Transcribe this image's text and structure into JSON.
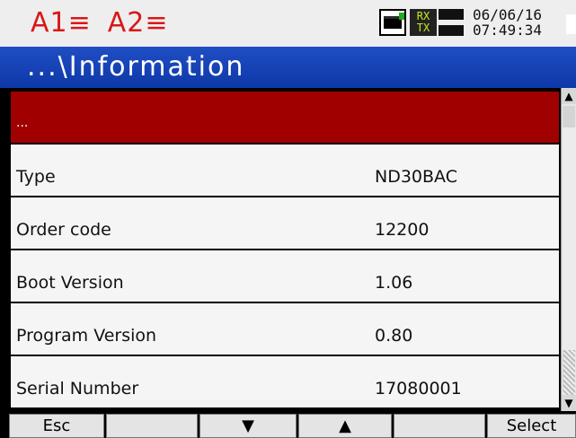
{
  "status": {
    "alarm1": "A1≡",
    "alarm2": "A2≡",
    "rx_label": "RX",
    "tx_label": "TX",
    "date": "06/06/16",
    "time": "07:49:34",
    "icons": [
      "display-flag-icon",
      "rx-tx-indicator-icon"
    ]
  },
  "title": "...\\Information",
  "list": {
    "header_label": "...",
    "rows": [
      {
        "label": "Type",
        "value": "ND30BAC"
      },
      {
        "label": "Order code",
        "value": "12200"
      },
      {
        "label": "Boot Version",
        "value": "1.06"
      },
      {
        "label": "Program Version",
        "value": "0.80"
      },
      {
        "label": "Serial Number",
        "value": "17080001"
      }
    ]
  },
  "softkeys": [
    "Esc",
    "",
    "▼",
    "▲",
    "",
    "Select"
  ],
  "colors": {
    "title_bar": "#1a46bd",
    "header_row": "#a00000",
    "alarm_text": "#d81818"
  }
}
